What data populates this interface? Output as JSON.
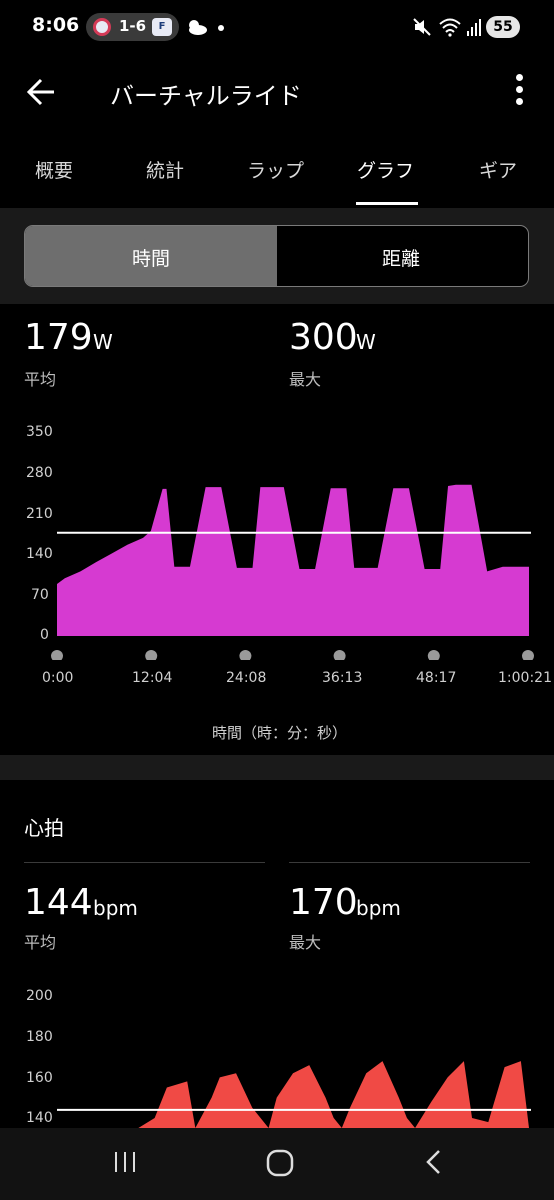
{
  "status_bar": {
    "time": "8:06",
    "score": "1-6",
    "team2_abbr": "F",
    "battery": "55"
  },
  "app_bar": {
    "title": "バーチャルライド"
  },
  "tabs": [
    {
      "label": "概要",
      "selected": false
    },
    {
      "label": "統計",
      "selected": false
    },
    {
      "label": "ラップ",
      "selected": false
    },
    {
      "label": "グラフ",
      "selected": true
    },
    {
      "label": "ギア",
      "selected": false
    }
  ],
  "segment": {
    "options": [
      "時間",
      "距離"
    ],
    "selected": "時間"
  },
  "power": {
    "avg_value": "179",
    "avg_unit": "W",
    "avg_label": "平均",
    "max_value": "300",
    "max_unit": "W",
    "max_label": "最大"
  },
  "heart_rate": {
    "section_title": "心拍",
    "avg_value": "144",
    "avg_unit": "bpm",
    "avg_label": "平均",
    "max_value": "170",
    "max_unit": "bpm",
    "max_label": "最大"
  },
  "chart_data": [
    {
      "type": "area",
      "color": "#d63ad1",
      "average_line": 179,
      "ylim": [
        0,
        350
      ],
      "yticks": [
        "350",
        "280",
        "210",
        "140",
        "70",
        "0"
      ],
      "xticks": [
        "0:00",
        "12:04",
        "24:08",
        "36:13",
        "48:17",
        "1:00:21"
      ],
      "xlabel": "時間（時：分：秒）",
      "x": [
        0,
        1,
        3,
        5,
        7,
        9,
        11,
        12,
        13.5,
        14,
        15,
        17,
        19,
        21,
        23,
        25,
        26,
        27,
        29,
        31,
        33,
        35,
        37,
        38,
        39,
        41,
        43,
        45,
        47,
        49,
        50,
        51,
        53,
        55,
        57,
        59,
        60,
        60.35
      ],
      "values": [
        90,
        100,
        112,
        128,
        143,
        158,
        170,
        182,
        255,
        255,
        120,
        120,
        258,
        258,
        118,
        118,
        258,
        258,
        258,
        116,
        116,
        256,
        256,
        118,
        118,
        118,
        256,
        256,
        116,
        116,
        260,
        262,
        262,
        112,
        120,
        120,
        120,
        120
      ]
    },
    {
      "type": "area",
      "color": "#f04a45",
      "average_line": 144,
      "ylim": [
        140,
        200
      ],
      "yticks": [
        "200",
        "180",
        "160",
        "140"
      ],
      "x": [
        0,
        10,
        12,
        13.5,
        16,
        17,
        19,
        20,
        22,
        24,
        26,
        27,
        29,
        31,
        33,
        34,
        35,
        36,
        38,
        40,
        42,
        43,
        44,
        46,
        48,
        50,
        51,
        53,
        55,
        57,
        58
      ],
      "values": [
        120,
        120,
        140,
        155,
        158,
        135,
        150,
        160,
        162,
        145,
        135,
        150,
        162,
        166,
        150,
        140,
        135,
        145,
        162,
        168,
        150,
        140,
        135,
        148,
        160,
        168,
        140,
        138,
        165,
        168,
        120
      ]
    }
  ]
}
